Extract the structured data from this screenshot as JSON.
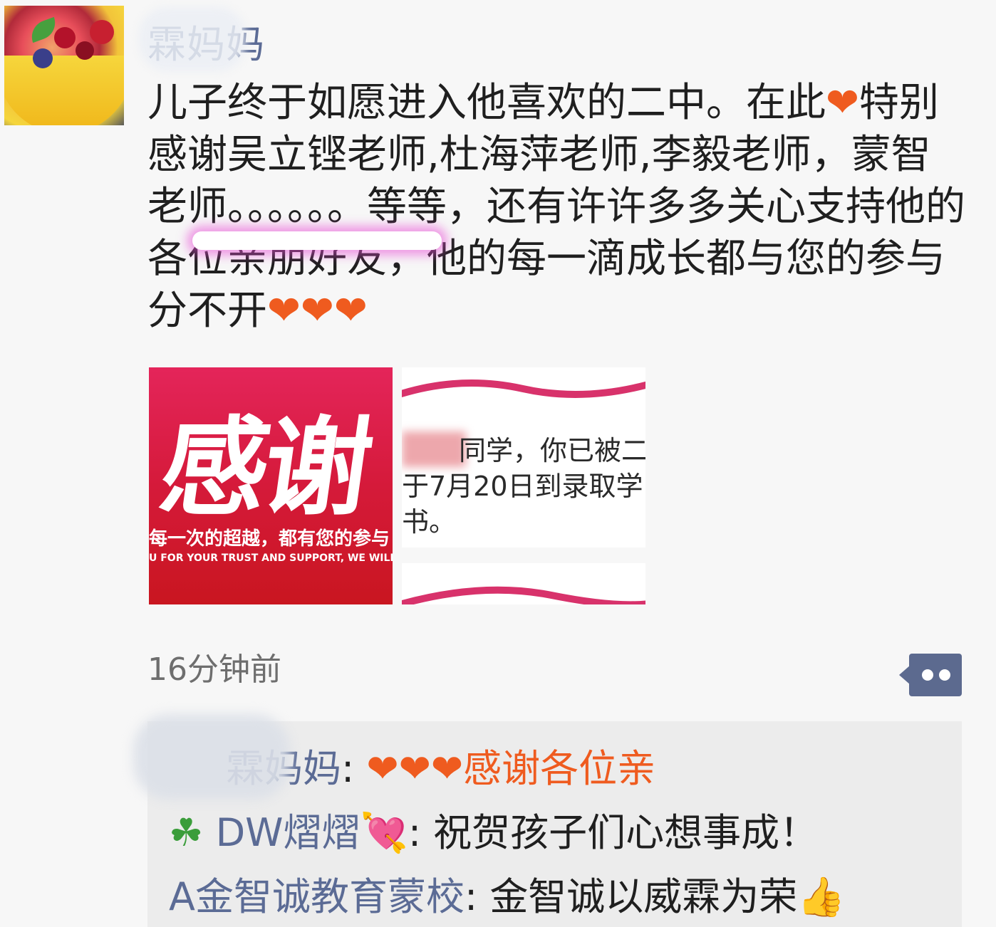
{
  "post": {
    "author": "霖妈妈",
    "text_before_heart": "儿子终于如愿进入他喜欢的二中。在此",
    "text_body": "特别感谢吴立铿老师,杜海萍老师,李毅老师，蒙智老师。。。。。。等等，还有许许多多关心支持他的各位亲朋好友，他的每一滴成长都与您的参与分不开",
    "heart": "❤",
    "timestamp": "16分钟前"
  },
  "images": [
    {
      "big_text": "感谢",
      "line1": "每一次的超越，都有您的参与",
      "line2": "U FOR YOUR TRUST AND SUPPORT, WE WILL WO"
    },
    {
      "line1": "同学，你已被二",
      "line2": "于7月20日到录取学",
      "line3": "书。"
    }
  ],
  "actions": {
    "more_icon": "more-dots-icon"
  },
  "comments": [
    {
      "author": "霖妈妈",
      "separator": ": ",
      "prefix_icons": "",
      "text": "❤❤❤感谢各位亲"
    },
    {
      "author_prefix": "☘",
      "author": " DW熠熠",
      "author_suffix": "💘",
      "separator": ": ",
      "text": "祝贺孩子们心想事成！"
    },
    {
      "author": "A金智诚教育蒙校",
      "separator": ": ",
      "text": "金智诚以威霖为荣",
      "suffix": "👍"
    }
  ],
  "colors": {
    "link": "#5b6b95",
    "heart": "#ef5b1f",
    "comment_bg": "#ececec",
    "page_bg": "#f7f7f7"
  }
}
